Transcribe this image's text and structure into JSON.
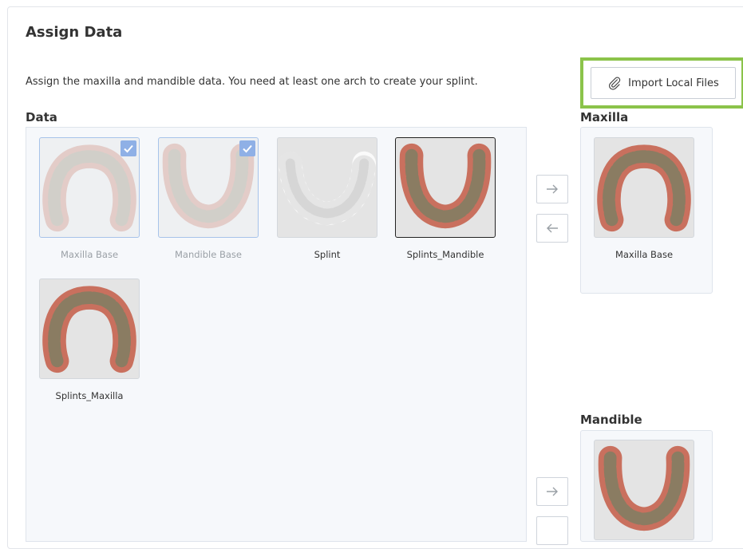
{
  "header": {
    "title": "Assign Data",
    "description": "Assign the maxilla and mandible data. You need at least one arch to create your splint."
  },
  "import_button": {
    "label": "Import Local Files",
    "icon": "paperclip-icon"
  },
  "data_section": {
    "label": "Data",
    "items": [
      {
        "label": "Maxilla Base",
        "shape": "maxilla",
        "assigned": true
      },
      {
        "label": "Mandible Base",
        "shape": "mandible",
        "assigned": true
      },
      {
        "label": "Splint",
        "shape": "splint",
        "assigned": false
      },
      {
        "label": "Splints_Mandible",
        "shape": "mandible",
        "assigned": false,
        "selected": true
      },
      {
        "label": "Splints_Maxilla",
        "shape": "maxilla",
        "assigned": false
      }
    ]
  },
  "maxilla_section": {
    "label": "Maxilla",
    "item_label": "Maxilla Base"
  },
  "mandible_section": {
    "label": "Mandible"
  },
  "colors": {
    "highlight": "#8bc34a",
    "check": "#8fb0e6",
    "gum": "#c9705e",
    "tooth": "#8a7c62"
  }
}
